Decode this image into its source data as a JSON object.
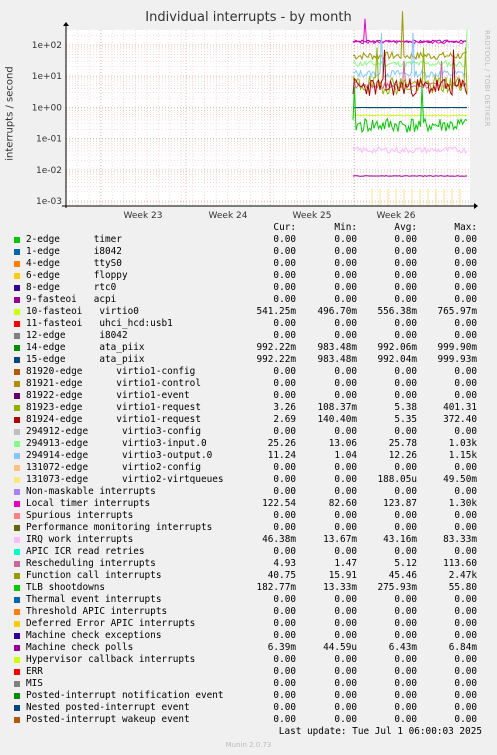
{
  "chart_data": {
    "type": "line",
    "title": "Individual interrupts - by month",
    "ylabel": "interrupts / second",
    "yscale": "log",
    "ylim": [
      0.0007,
      300
    ],
    "yticks": [
      "1e+02",
      "1e+01",
      "1e+00",
      "1e-01",
      "1e-02",
      "1e-03"
    ],
    "ytick_values": [
      100,
      10,
      1,
      0.1,
      0.01,
      0.001
    ],
    "x_ticks": [
      "Week 23",
      "Week 24",
      "Week 25",
      "Week 26"
    ],
    "grid": true,
    "watermark": "RRDTOOL / TOBI OETIKER",
    "columns": [
      "Cur:",
      "Min:",
      "Avg:",
      "Max:"
    ],
    "series": [
      {
        "name": "2-edge      timer",
        "color": "#00cc00",
        "cur": "0.00",
        "min": "0.00",
        "avg": "0.00",
        "max": "0.00"
      },
      {
        "name": "1-edge      i8042",
        "color": "#0066b3",
        "cur": "0.00",
        "min": "0.00",
        "avg": "0.00",
        "max": "0.00"
      },
      {
        "name": "4-edge      ttyS0",
        "color": "#ff8000",
        "cur": "0.00",
        "min": "0.00",
        "avg": "0.00",
        "max": "0.00"
      },
      {
        "name": "6-edge      floppy",
        "color": "#ffcc00",
        "cur": "0.00",
        "min": "0.00",
        "avg": "0.00",
        "max": "0.00"
      },
      {
        "name": "8-edge      rtc0",
        "color": "#330099",
        "cur": "0.00",
        "min": "0.00",
        "avg": "0.00",
        "max": "0.00"
      },
      {
        "name": "9-fasteoi   acpi",
        "color": "#990099",
        "cur": "0.00",
        "min": "0.00",
        "avg": "0.00",
        "max": "0.00"
      },
      {
        "name": "10-fasteoi   virtio0",
        "color": "#ccff00",
        "cur": "541.25m",
        "min": "496.70m",
        "avg": "556.38m",
        "max": "765.97m"
      },
      {
        "name": "11-fasteoi   uhci_hcd:usb1",
        "color": "#ff0000",
        "cur": "0.00",
        "min": "0.00",
        "avg": "0.00",
        "max": "0.00"
      },
      {
        "name": "12-edge      i8042",
        "color": "#808080",
        "cur": "0.00",
        "min": "0.00",
        "avg": "0.00",
        "max": "0.00"
      },
      {
        "name": "14-edge      ata_piix",
        "color": "#008f00",
        "cur": "992.22m",
        "min": "983.48m",
        "avg": "992.06m",
        "max": "999.90m"
      },
      {
        "name": "15-edge      ata_piix",
        "color": "#00487d",
        "cur": "992.22m",
        "min": "983.48m",
        "avg": "992.04m",
        "max": "999.93m"
      },
      {
        "name": "81920-edge      virtio1-config",
        "color": "#b35a00",
        "cur": "0.00",
        "min": "0.00",
        "avg": "0.00",
        "max": "0.00"
      },
      {
        "name": "81921-edge      virtio1-control",
        "color": "#b38f00",
        "cur": "0.00",
        "min": "0.00",
        "avg": "0.00",
        "max": "0.00"
      },
      {
        "name": "81922-edge      virtio1-event",
        "color": "#6b006b",
        "cur": "0.00",
        "min": "0.00",
        "avg": "0.00",
        "max": "0.00"
      },
      {
        "name": "81923-edge      virtio1-request",
        "color": "#8fb300",
        "cur": "3.26",
        "min": "108.37m",
        "avg": "5.38",
        "max": "401.31"
      },
      {
        "name": "81924-edge      virtio1-request",
        "color": "#b30000",
        "cur": "2.69",
        "min": "140.40m",
        "avg": "5.35",
        "max": "372.40"
      },
      {
        "name": "294912-edge      virtio3-config",
        "color": "#bebebe",
        "cur": "0.00",
        "min": "0.00",
        "avg": "0.00",
        "max": "0.00"
      },
      {
        "name": "294913-edge      virtio3-input.0",
        "color": "#80ff80",
        "cur": "25.26",
        "min": "13.06",
        "avg": "25.78",
        "max": "1.03k"
      },
      {
        "name": "294914-edge      virtio3-output.0",
        "color": "#80c9ff",
        "cur": "11.24",
        "min": "1.04",
        "avg": "12.26",
        "max": "1.15k"
      },
      {
        "name": "131072-edge      virtio2-config",
        "color": "#ffc080",
        "cur": "0.00",
        "min": "0.00",
        "avg": "0.00",
        "max": "0.00"
      },
      {
        "name": "131073-edge      virtio2-virtqueues",
        "color": "#ffe680",
        "cur": "0.00",
        "min": "0.00",
        "avg": "188.05u",
        "max": "49.50m"
      },
      {
        "name": "Non-maskable interrupts",
        "color": "#aa80ff",
        "cur": "0.00",
        "min": "0.00",
        "avg": "0.00",
        "max": "0.00"
      },
      {
        "name": "Local timer interrupts",
        "color": "#ee00cc",
        "cur": "122.54",
        "min": "82.60",
        "avg": "123.87",
        "max": "1.30k"
      },
      {
        "name": "Spurious interrupts",
        "color": "#ff8080",
        "cur": "0.00",
        "min": "0.00",
        "avg": "0.00",
        "max": "0.00"
      },
      {
        "name": "Performance monitoring interrupts",
        "color": "#666600",
        "cur": "0.00",
        "min": "0.00",
        "avg": "0.00",
        "max": "0.00"
      },
      {
        "name": "IRQ work interrupts",
        "color": "#ffbbff",
        "cur": "46.38m",
        "min": "13.67m",
        "avg": "43.16m",
        "max": "83.33m"
      },
      {
        "name": "APIC ICR read retries",
        "color": "#00ffcc",
        "cur": "0.00",
        "min": "0.00",
        "avg": "0.00",
        "max": "0.00"
      },
      {
        "name": "Rescheduling interrupts",
        "color": "#cc6699",
        "cur": "4.93",
        "min": "1.47",
        "avg": "5.12",
        "max": "113.60"
      },
      {
        "name": "Function call interrupts",
        "color": "#999900",
        "cur": "40.75",
        "min": "15.91",
        "avg": "45.46",
        "max": "2.47k"
      },
      {
        "name": "TLB shootdowns",
        "color": "#00cc00",
        "cur": "182.77m",
        "min": "13.33m",
        "avg": "275.93m",
        "max": "55.80"
      },
      {
        "name": "Thermal event interrupts",
        "color": "#0066b3",
        "cur": "0.00",
        "min": "0.00",
        "avg": "0.00",
        "max": "0.00"
      },
      {
        "name": "Threshold APIC interrupts",
        "color": "#ff8000",
        "cur": "0.00",
        "min": "0.00",
        "avg": "0.00",
        "max": "0.00"
      },
      {
        "name": "Deferred Error APIC interrupts",
        "color": "#ffcc00",
        "cur": "0.00",
        "min": "0.00",
        "avg": "0.00",
        "max": "0.00"
      },
      {
        "name": "Machine check exceptions",
        "color": "#330099",
        "cur": "0.00",
        "min": "0.00",
        "avg": "0.00",
        "max": "0.00"
      },
      {
        "name": "Machine check polls",
        "color": "#990099",
        "cur": "6.39m",
        "min": "44.59u",
        "avg": "6.43m",
        "max": "6.84m"
      },
      {
        "name": "Hypervisor callback interrupts",
        "color": "#ccff00",
        "cur": "0.00",
        "min": "0.00",
        "avg": "0.00",
        "max": "0.00"
      },
      {
        "name": "ERR",
        "color": "#ff0000",
        "cur": "0.00",
        "min": "0.00",
        "avg": "0.00",
        "max": "0.00"
      },
      {
        "name": "MIS",
        "color": "#808080",
        "cur": "0.00",
        "min": "0.00",
        "avg": "0.00",
        "max": "0.00"
      },
      {
        "name": "Posted-interrupt notification event",
        "color": "#008f00",
        "cur": "0.00",
        "min": "0.00",
        "avg": "0.00",
        "max": "0.00"
      },
      {
        "name": "Nested posted-interrupt event",
        "color": "#00487d",
        "cur": "0.00",
        "min": "0.00",
        "avg": "0.00",
        "max": "0.00"
      },
      {
        "name": "Posted-interrupt wakeup event",
        "color": "#b35a00",
        "cur": "0.00",
        "min": "0.00",
        "avg": "0.00",
        "max": "0.00"
      }
    ]
  },
  "footer": {
    "last_update": "Last update: Tue Jul  1 06:00:03 2025",
    "munin": "Munin 2.0.73"
  }
}
